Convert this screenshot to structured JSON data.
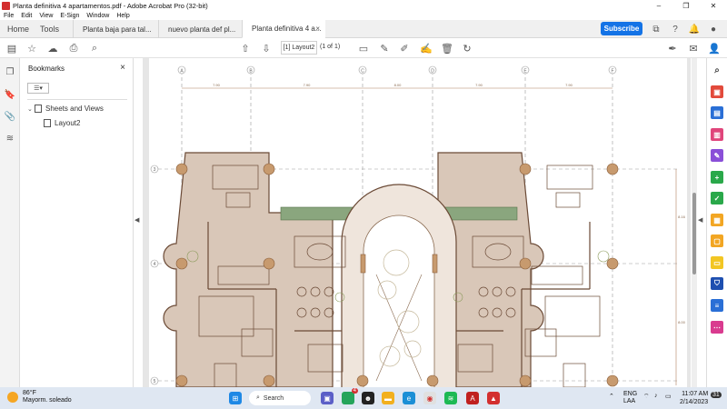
{
  "window": {
    "title": "Planta definitiva 4 apartamentos.pdf - Adobe Acrobat Pro (32-bit)"
  },
  "menu": [
    "File",
    "Edit",
    "View",
    "E-Sign",
    "Window",
    "Help"
  ],
  "tabs": {
    "home": "Home",
    "tools": "Tools",
    "documents": [
      {
        "label": "Planta baja para tal...",
        "active": false
      },
      {
        "label": "nuevo planta def pl...",
        "active": false
      },
      {
        "label": "Planta definitiva 4 a...",
        "active": true
      }
    ],
    "close": "×",
    "subscribe": "Subscribe"
  },
  "toolbar": {
    "page_label": "[1] Layout2",
    "page_of": "(1 of 1)"
  },
  "bookmarks": {
    "title": "Bookmarks",
    "close": "×",
    "options": "☰▾",
    "items": [
      {
        "label": "Sheets and Views",
        "expanded": true
      },
      {
        "label": "Layout2"
      }
    ]
  },
  "drawing": {
    "grid_columns": [
      "A",
      "B",
      "C",
      "D",
      "E",
      "F"
    ],
    "grid_rows": [
      "3",
      "4",
      "5"
    ],
    "dims": [
      "7.90",
      "7.90",
      "8.00",
      "7.90",
      "7.90"
    ],
    "side_dims": [
      "8.16",
      "8.00"
    ]
  },
  "taskbar": {
    "weather_temp": "86°F",
    "weather_desc": "Mayorm. soleado",
    "search": "Search",
    "chat_badge": "4",
    "lang_1": "ENG",
    "lang_2": "LAA",
    "time": "11:07 AM",
    "date": "2/14/2023",
    "notif": "31"
  },
  "colors": {
    "accent": "#1473e6",
    "acrobat_red": "#d32f2f",
    "floor_fill": "#d9c7b8",
    "column_fill": "#c79a6e",
    "wall": "#6b4a36",
    "garden": "#8aa67e"
  }
}
